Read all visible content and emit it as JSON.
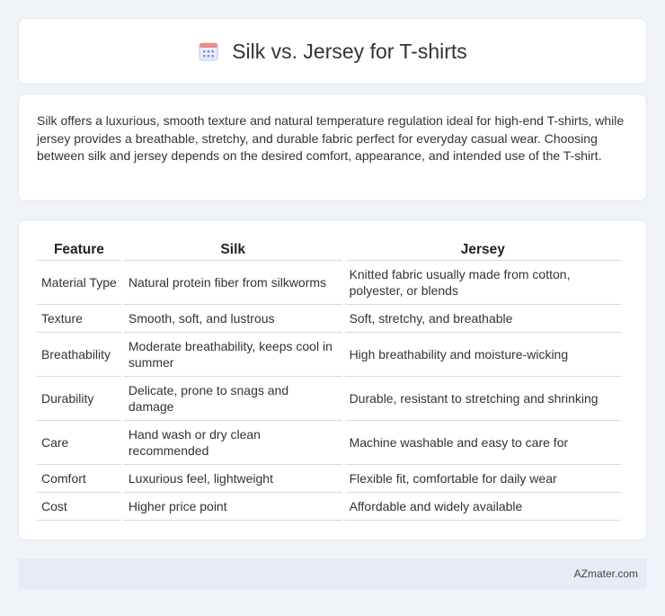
{
  "header": {
    "title": "Silk vs. Jersey for T-shirts",
    "icon": "calendar-icon"
  },
  "intro": {
    "text": "Silk offers a luxurious, smooth texture and natural temperature regulation ideal for high-end T-shirts, while jersey provides a breathable, stretchy, and durable fabric perfect for everyday casual wear. Choosing between silk and jersey depends on the desired comfort, appearance, and intended use of the T-shirt."
  },
  "table": {
    "headers": [
      "Feature",
      "Silk",
      "Jersey"
    ],
    "rows": [
      [
        "Material Type",
        "Natural protein fiber from silkworms",
        "Knitted fabric usually made from cotton, polyester, or blends"
      ],
      [
        "Texture",
        "Smooth, soft, and lustrous",
        "Soft, stretchy, and breathable"
      ],
      [
        "Breathability",
        "Moderate breathability, keeps cool in summer",
        "High breathability and moisture-wicking"
      ],
      [
        "Durability",
        "Delicate, prone to snags and damage",
        "Durable, resistant to stretching and shrinking"
      ],
      [
        "Care",
        "Hand wash or dry clean recommended",
        "Machine washable and easy to care for"
      ],
      [
        "Comfort",
        "Luxurious feel, lightweight",
        "Flexible fit, comfortable for daily wear"
      ],
      [
        "Cost",
        "Higher price point",
        "Affordable and widely available"
      ]
    ]
  },
  "footer": {
    "text": "AZmater.com"
  },
  "colors": {
    "background": "#f0f3f8",
    "footer_bg": "#e6ebf5",
    "icon_accent": "#5b8def"
  }
}
